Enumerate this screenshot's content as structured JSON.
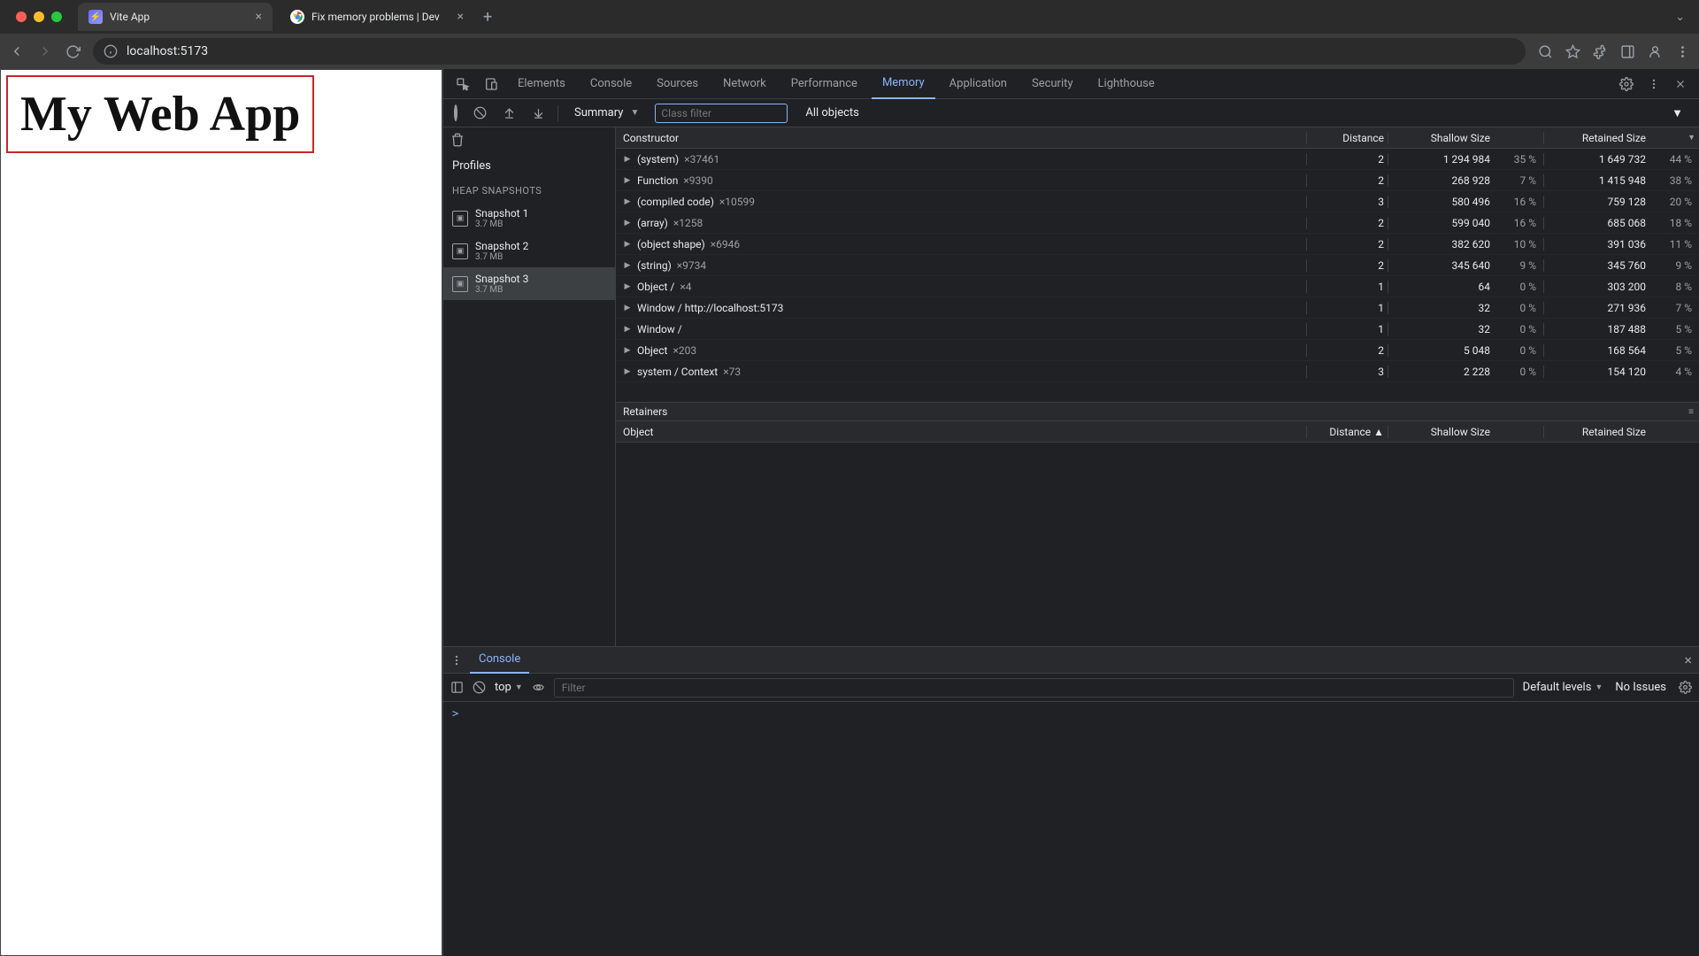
{
  "tabs": [
    {
      "title": "Vite App"
    },
    {
      "title": "Fix memory problems  |  Dev"
    }
  ],
  "address": "localhost:5173",
  "page": {
    "heading": "My Web App"
  },
  "devtools": {
    "tabs": [
      "Elements",
      "Console",
      "Sources",
      "Network",
      "Performance",
      "Memory",
      "Application",
      "Security",
      "Lighthouse"
    ],
    "active_tab": "Memory"
  },
  "memory": {
    "view_select": "Summary",
    "class_filter_placeholder": "Class filter",
    "objects_select": "All objects",
    "profiles_label": "Profiles",
    "heap_section": "HEAP SNAPSHOTS",
    "snapshots": [
      {
        "name": "Snapshot 1",
        "size": "3.7 MB"
      },
      {
        "name": "Snapshot 2",
        "size": "3.7 MB"
      },
      {
        "name": "Snapshot 3",
        "size": "3.7 MB"
      }
    ],
    "selected_snapshot": 2,
    "columns": {
      "constructor": "Constructor",
      "distance": "Distance",
      "shallow": "Shallow Size",
      "retained": "Retained Size"
    },
    "rows": [
      {
        "name": "(system)",
        "count": "×37461",
        "dist": "2",
        "shallow": "1 294 984",
        "shallow_pct": "35 %",
        "retained": "1 649 732",
        "retained_pct": "44 %"
      },
      {
        "name": "Function",
        "count": "×9390",
        "dist": "2",
        "shallow": "268 928",
        "shallow_pct": "7 %",
        "retained": "1 415 948",
        "retained_pct": "38 %"
      },
      {
        "name": "(compiled code)",
        "count": "×10599",
        "dist": "3",
        "shallow": "580 496",
        "shallow_pct": "16 %",
        "retained": "759 128",
        "retained_pct": "20 %"
      },
      {
        "name": "(array)",
        "count": "×1258",
        "dist": "2",
        "shallow": "599 040",
        "shallow_pct": "16 %",
        "retained": "685 068",
        "retained_pct": "18 %"
      },
      {
        "name": "(object shape)",
        "count": "×6946",
        "dist": "2",
        "shallow": "382 620",
        "shallow_pct": "10 %",
        "retained": "391 036",
        "retained_pct": "11 %"
      },
      {
        "name": "(string)",
        "count": "×9734",
        "dist": "2",
        "shallow": "345 640",
        "shallow_pct": "9 %",
        "retained": "345 760",
        "retained_pct": "9 %"
      },
      {
        "name": "Object /",
        "count": "×4",
        "dist": "1",
        "shallow": "64",
        "shallow_pct": "0 %",
        "retained": "303 200",
        "retained_pct": "8 %"
      },
      {
        "name": "Window / http://localhost:5173",
        "count": "",
        "dist": "1",
        "shallow": "32",
        "shallow_pct": "0 %",
        "retained": "271 936",
        "retained_pct": "7 %"
      },
      {
        "name": "Window /",
        "count": "",
        "dist": "1",
        "shallow": "32",
        "shallow_pct": "0 %",
        "retained": "187 488",
        "retained_pct": "5 %"
      },
      {
        "name": "Object",
        "count": "×203",
        "dist": "2",
        "shallow": "5 048",
        "shallow_pct": "0 %",
        "retained": "168 564",
        "retained_pct": "5 %"
      },
      {
        "name": "system / Context",
        "count": "×73",
        "dist": "3",
        "shallow": "2 228",
        "shallow_pct": "0 %",
        "retained": "154 120",
        "retained_pct": "4 %"
      }
    ],
    "retainers_label": "Retainers",
    "retainers_columns": {
      "object": "Object",
      "distance": "Distance ▲",
      "shallow": "Shallow Size",
      "retained": "Retained Size"
    }
  },
  "console": {
    "tab": "Console",
    "context": "top",
    "filter_placeholder": "Filter",
    "levels": "Default levels",
    "issues": "No Issues",
    "prompt": ">"
  }
}
